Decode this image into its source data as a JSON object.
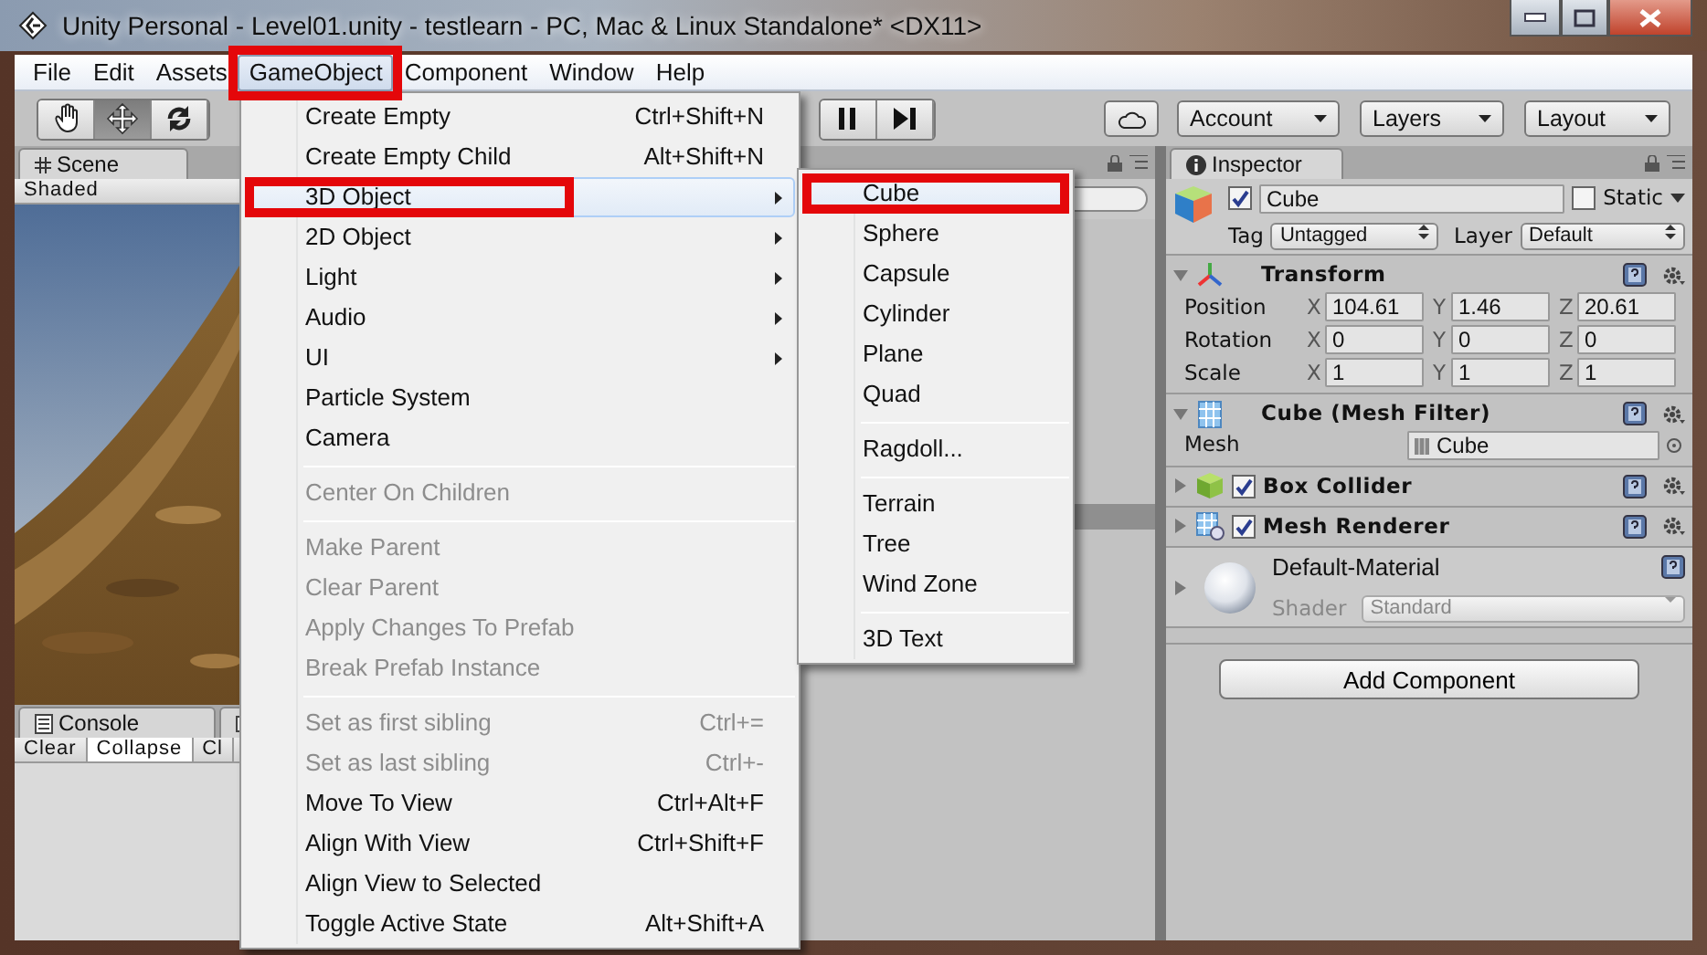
{
  "window": {
    "title": "Unity Personal - Level01.unity - testlearn - PC, Mac & Linux Standalone* <DX11>"
  },
  "menu_bar": [
    {
      "label": "File",
      "selected": false,
      "marked": false
    },
    {
      "label": "Edit",
      "selected": false,
      "marked": false
    },
    {
      "label": "Assets",
      "selected": false,
      "marked": false
    },
    {
      "label": "GameObject",
      "selected": true,
      "marked": true
    },
    {
      "label": "Component",
      "selected": false,
      "marked": false
    },
    {
      "label": "Window",
      "selected": false,
      "marked": false
    },
    {
      "label": "Help",
      "selected": false,
      "marked": false
    }
  ],
  "toolbar": {
    "tools": [
      {
        "kind": "hand",
        "selected": false
      },
      {
        "kind": "move",
        "selected": true
      },
      {
        "kind": "rotate",
        "selected": false
      }
    ],
    "playback": [
      {
        "kind": "pause"
      },
      {
        "kind": "step"
      }
    ],
    "dropdowns": [
      "Account",
      "Layers",
      "Layout"
    ]
  },
  "scene": {
    "tab": "Scene",
    "shading": "Shaded"
  },
  "console": {
    "tab": "Console",
    "buttons": [
      {
        "label": "Clear",
        "selected": false
      },
      {
        "label": "Collapse",
        "selected": true
      },
      {
        "label": "Cl",
        "selected": false
      }
    ]
  },
  "inspector": {
    "tab": "Inspector",
    "object": {
      "active": true,
      "name": "Cube",
      "static": false,
      "static_label": "Static",
      "tag_label": "Tag",
      "tag": "Untagged",
      "layer_label": "Layer",
      "layer": "Default"
    },
    "components": [
      {
        "kind": "transform",
        "title": "Transform",
        "expanded": true,
        "rows": [
          {
            "label": "Position",
            "fields": [
              {
                "axis": "X",
                "value": "104.61"
              },
              {
                "axis": "Y",
                "value": "1.46"
              },
              {
                "axis": "Z",
                "value": "20.61"
              }
            ]
          },
          {
            "label": "Rotation",
            "fields": [
              {
                "axis": "X",
                "value": "0"
              },
              {
                "axis": "Y",
                "value": "0"
              },
              {
                "axis": "Z",
                "value": "0"
              }
            ]
          },
          {
            "label": "Scale",
            "fields": [
              {
                "axis": "X",
                "value": "1"
              },
              {
                "axis": "Y",
                "value": "1"
              },
              {
                "axis": "Z",
                "value": "1"
              }
            ]
          }
        ]
      },
      {
        "kind": "mesh_filter",
        "title": "Cube (Mesh Filter)",
        "expanded": true,
        "property": {
          "label": "Mesh",
          "value": "Cube"
        }
      },
      {
        "kind": "box_collider",
        "title": "Box Collider",
        "expanded": false,
        "enabled": true
      },
      {
        "kind": "mesh_renderer",
        "title": "Mesh Renderer",
        "expanded": false,
        "enabled": true
      }
    ],
    "material": {
      "name": "Default-Material",
      "shader_label": "Shader",
      "shader": "Standard",
      "expanded": false
    },
    "add_button": "Add Component"
  },
  "gameobject_menu": {
    "items": [
      {
        "kind": "item",
        "label": "Create Empty",
        "shortcut": "Ctrl+Shift+N",
        "submenu": false,
        "disabled": false,
        "selected": false,
        "marked": false
      },
      {
        "kind": "item",
        "label": "Create Empty Child",
        "shortcut": "Alt+Shift+N",
        "submenu": false,
        "disabled": false,
        "selected": false,
        "marked": false
      },
      {
        "kind": "item",
        "label": "3D Object",
        "submenu": true,
        "disabled": false,
        "selected": true,
        "marked": true
      },
      {
        "kind": "item",
        "label": "2D Object",
        "submenu": true,
        "disabled": false,
        "selected": false,
        "marked": false
      },
      {
        "kind": "item",
        "label": "Light",
        "submenu": true,
        "disabled": false,
        "selected": false,
        "marked": false
      },
      {
        "kind": "item",
        "label": "Audio",
        "submenu": true,
        "disabled": false,
        "selected": false,
        "marked": false
      },
      {
        "kind": "item",
        "label": "UI",
        "submenu": true,
        "disabled": false,
        "selected": false,
        "marked": false
      },
      {
        "kind": "item",
        "label": "Particle System",
        "submenu": false,
        "disabled": false,
        "selected": false,
        "marked": false
      },
      {
        "kind": "item",
        "label": "Camera",
        "submenu": false,
        "disabled": false,
        "selected": false,
        "marked": false
      },
      {
        "kind": "separator"
      },
      {
        "kind": "item",
        "label": "Center On Children",
        "submenu": false,
        "disabled": true,
        "selected": false,
        "marked": false
      },
      {
        "kind": "separator"
      },
      {
        "kind": "item",
        "label": "Make Parent",
        "submenu": false,
        "disabled": true,
        "selected": false,
        "marked": false
      },
      {
        "kind": "item",
        "label": "Clear Parent",
        "submenu": false,
        "disabled": true,
        "selected": false,
        "marked": false
      },
      {
        "kind": "item",
        "label": "Apply Changes To Prefab",
        "submenu": false,
        "disabled": true,
        "selected": false,
        "marked": false
      },
      {
        "kind": "item",
        "label": "Break Prefab Instance",
        "submenu": false,
        "disabled": true,
        "selected": false,
        "marked": false
      },
      {
        "kind": "separator"
      },
      {
        "kind": "item",
        "label": "Set as first sibling",
        "shortcut": "Ctrl+=",
        "submenu": false,
        "disabled": true,
        "selected": false,
        "marked": false
      },
      {
        "kind": "item",
        "label": "Set as last sibling",
        "shortcut": "Ctrl+-",
        "submenu": false,
        "disabled": true,
        "selected": false,
        "marked": false
      },
      {
        "kind": "item",
        "label": "Move To View",
        "shortcut": "Ctrl+Alt+F",
        "submenu": false,
        "disabled": false,
        "selected": false,
        "marked": false
      },
      {
        "kind": "item",
        "label": "Align With View",
        "shortcut": "Ctrl+Shift+F",
        "submenu": false,
        "disabled": false,
        "selected": false,
        "marked": false
      },
      {
        "kind": "item",
        "label": "Align View to Selected",
        "submenu": false,
        "disabled": false,
        "selected": false,
        "marked": false
      },
      {
        "kind": "item",
        "label": "Toggle Active State",
        "shortcut": "Alt+Shift+A",
        "submenu": false,
        "disabled": false,
        "selected": false,
        "marked": false
      }
    ]
  },
  "object_submenu": {
    "items": [
      {
        "kind": "item",
        "label": "Cube",
        "submenu": false,
        "disabled": false,
        "selected": true,
        "marked": true
      },
      {
        "kind": "item",
        "label": "Sphere",
        "submenu": false,
        "disabled": false,
        "selected": false,
        "marked": false
      },
      {
        "kind": "item",
        "label": "Capsule",
        "submenu": false,
        "disabled": false,
        "selected": false,
        "marked": false
      },
      {
        "kind": "item",
        "label": "Cylinder",
        "submenu": false,
        "disabled": false,
        "selected": false,
        "marked": false
      },
      {
        "kind": "item",
        "label": "Plane",
        "submenu": false,
        "disabled": false,
        "selected": false,
        "marked": false
      },
      {
        "kind": "item",
        "label": "Quad",
        "submenu": false,
        "disabled": false,
        "selected": false,
        "marked": false
      },
      {
        "kind": "separator"
      },
      {
        "kind": "item",
        "label": "Ragdoll...",
        "submenu": false,
        "disabled": false,
        "selected": false,
        "marked": false
      },
      {
        "kind": "separator"
      },
      {
        "kind": "item",
        "label": "Terrain",
        "submenu": false,
        "disabled": false,
        "selected": false,
        "marked": false
      },
      {
        "kind": "item",
        "label": "Tree",
        "submenu": false,
        "disabled": false,
        "selected": false,
        "marked": false
      },
      {
        "kind": "item",
        "label": "Wind Zone",
        "submenu": false,
        "disabled": false,
        "selected": false,
        "marked": false
      },
      {
        "kind": "separator"
      },
      {
        "kind": "item",
        "label": "3D Text",
        "submenu": false,
        "disabled": false,
        "selected": false,
        "marked": false
      }
    ]
  }
}
